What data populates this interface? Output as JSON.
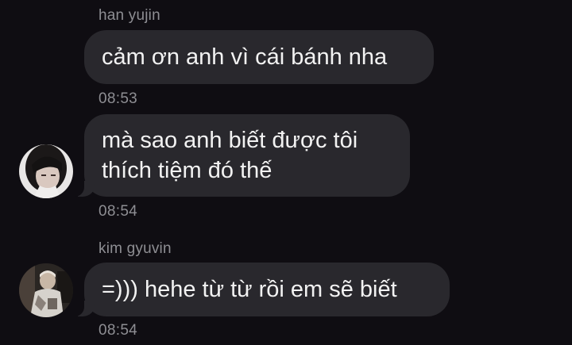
{
  "messages": [
    {
      "sender": "han yujin",
      "lines": [
        "cảm ơn anh vì cái bánh nha"
      ],
      "time": "08:53"
    },
    {
      "lines": [
        "mà sao anh biết được tôi",
        "thích tiệm đó thế"
      ],
      "time": "08:54"
    },
    {
      "sender": "kim gyuvin",
      "lines": [
        "=))) hehe từ từ rồi em sẽ biết"
      ],
      "time": "08:54"
    }
  ],
  "avatars": {
    "han_yujin": "avatar-han-yujin",
    "kim_gyuvin": "avatar-kim-gyuvin"
  },
  "colors": {
    "background": "#0f0d12",
    "bubble": "#29282d",
    "meta_text": "#8e8e93",
    "message_text": "#f2f2f2"
  }
}
